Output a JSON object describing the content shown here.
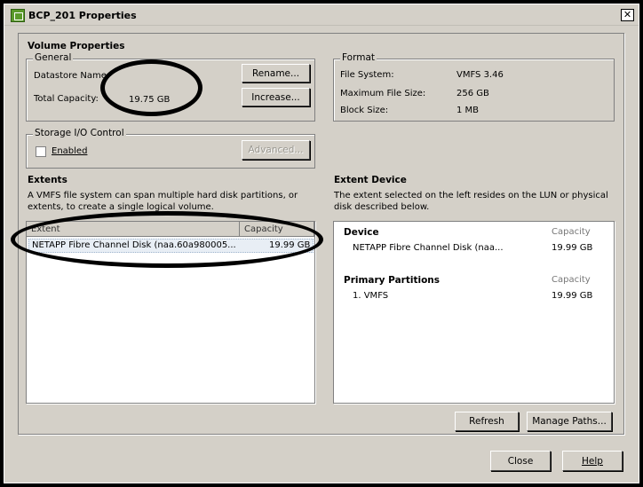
{
  "window": {
    "title": "BCP_201 Properties",
    "close_glyph": "✕"
  },
  "volume_properties": {
    "section_title": "Volume Properties",
    "general": {
      "legend": "General",
      "datastore_label": "Datastore Name:",
      "datastore_value": "",
      "total_capacity_label": "Total Capacity:",
      "total_capacity_value": "19.75 GB",
      "rename_label": "Rename...",
      "increase_label": "Increase..."
    },
    "format": {
      "legend": "Format",
      "rows": [
        {
          "label": "File System:",
          "value": "VMFS 3.46"
        },
        {
          "label": "Maximum File Size:",
          "value": "256 GB"
        },
        {
          "label": "Block Size:",
          "value": "1 MB"
        }
      ]
    },
    "storage_io": {
      "legend": "Storage I/O Control",
      "enabled_label": "Enabled",
      "enabled_checked": false,
      "advanced_label": "Advanced..."
    }
  },
  "extents": {
    "section_title": "Extents",
    "description": "A VMFS file system can span multiple hard disk partitions, or extents, to create a single logical volume.",
    "columns": [
      "Extent",
      "Capacity"
    ],
    "rows": [
      {
        "extent": "NETAPP Fibre Channel Disk (naa.60a980005...",
        "capacity": "19.99 GB"
      }
    ]
  },
  "extent_device": {
    "section_title": "Extent Device",
    "description": "The extent selected on the left resides on the LUN or physical disk described below.",
    "device_header": "Device",
    "capacity_header": "Capacity",
    "device_name": "NETAPP Fibre Channel Disk (naa...",
    "device_capacity": "19.99 GB",
    "partitions_header": "Primary Partitions",
    "partition_name": "1. VMFS",
    "partition_capacity": "19.99 GB",
    "refresh_label": "Refresh",
    "manage_paths_label": "Manage Paths..."
  },
  "footer": {
    "close_label": "Close",
    "help_label": "Help"
  },
  "annotation_color": "#000000"
}
